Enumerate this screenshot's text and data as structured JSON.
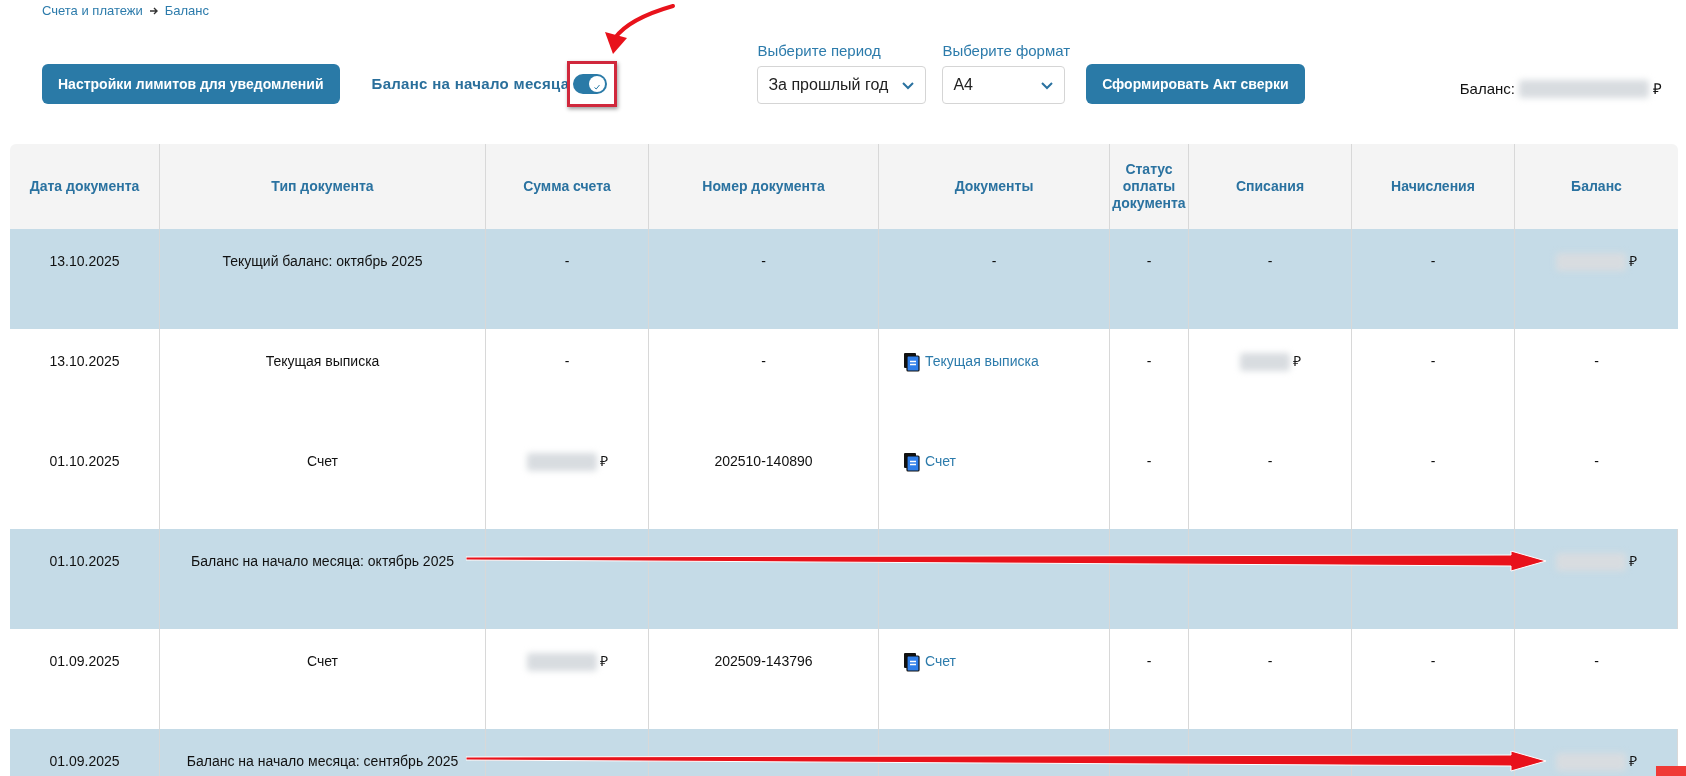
{
  "breadcrumbs": [
    {
      "label": "Счета и платежи"
    },
    {
      "label": "Баланс"
    }
  ],
  "toolbar": {
    "limits_button": "Настройки лимитов для уведомлений",
    "toggle": {
      "label": "Баланс на начало месяца",
      "on": true,
      "highlighted": true
    },
    "period": {
      "label": "Выберите период",
      "value": "За прошлый год"
    },
    "format": {
      "label": "Выберите формат",
      "value": "А4"
    },
    "act_button": "Сформировать Акт сверки",
    "balance": {
      "label": "Баланс:",
      "currency": "₽",
      "masked": true
    }
  },
  "table": {
    "columns": [
      "Дата документа",
      "Тип документа",
      "Сумма счета",
      "Номер документа",
      "Документы",
      "Статус оплаты документа",
      "Списания",
      "Начисления",
      "Баланс"
    ],
    "rows": [
      {
        "highlighted": true,
        "annotated": false,
        "cells": [
          {
            "kind": "text",
            "text": "13.10.2025"
          },
          {
            "kind": "text",
            "text": "Текущий баланс: октябрь 2025"
          },
          {
            "kind": "text",
            "text": "-"
          },
          {
            "kind": "text",
            "text": "-"
          },
          {
            "kind": "text",
            "text": "-"
          },
          {
            "kind": "text",
            "text": "-"
          },
          {
            "kind": "text",
            "text": "-"
          },
          {
            "kind": "text",
            "text": "-"
          },
          {
            "kind": "amount",
            "text": "₽"
          }
        ]
      },
      {
        "highlighted": false,
        "annotated": false,
        "cells": [
          {
            "kind": "text",
            "text": "13.10.2025"
          },
          {
            "kind": "text",
            "text": "Текущая выписка"
          },
          {
            "kind": "text",
            "text": "-"
          },
          {
            "kind": "text",
            "text": "-"
          },
          {
            "kind": "doc",
            "text": "Текущая выписка"
          },
          {
            "kind": "text",
            "text": "-"
          },
          {
            "kind": "amount",
            "text": "₽"
          },
          {
            "kind": "text",
            "text": "-"
          },
          {
            "kind": "text",
            "text": "-"
          }
        ]
      },
      {
        "highlighted": false,
        "annotated": false,
        "cells": [
          {
            "kind": "text",
            "text": "01.10.2025"
          },
          {
            "kind": "text",
            "text": "Счет"
          },
          {
            "kind": "amount",
            "text": "₽"
          },
          {
            "kind": "text",
            "text": "202510-140890"
          },
          {
            "kind": "doc",
            "text": "Счет"
          },
          {
            "kind": "text",
            "text": "-"
          },
          {
            "kind": "text",
            "text": "-"
          },
          {
            "kind": "text",
            "text": "-"
          },
          {
            "kind": "text",
            "text": "-"
          }
        ]
      },
      {
        "highlighted": true,
        "annotated": true,
        "cells": [
          {
            "kind": "text",
            "text": "01.10.2025"
          },
          {
            "kind": "text",
            "text": "Баланс на начало месяца: октябрь 2025"
          },
          {
            "kind": "none"
          },
          {
            "kind": "none"
          },
          {
            "kind": "none"
          },
          {
            "kind": "none"
          },
          {
            "kind": "none"
          },
          {
            "kind": "none"
          },
          {
            "kind": "amount",
            "text": "₽"
          }
        ]
      },
      {
        "highlighted": false,
        "annotated": false,
        "cells": [
          {
            "kind": "text",
            "text": "01.09.2025"
          },
          {
            "kind": "text",
            "text": "Счет"
          },
          {
            "kind": "amount",
            "text": "₽"
          },
          {
            "kind": "text",
            "text": "202509-143796"
          },
          {
            "kind": "doc",
            "text": "Счет"
          },
          {
            "kind": "text",
            "text": "-"
          },
          {
            "kind": "text",
            "text": "-"
          },
          {
            "kind": "text",
            "text": "-"
          },
          {
            "kind": "text",
            "text": "-"
          }
        ]
      },
      {
        "highlighted": true,
        "annotated": true,
        "cells": [
          {
            "kind": "text",
            "text": "01.09.2025"
          },
          {
            "kind": "text",
            "text": "Баланс на начало месяца: сентябрь 2025"
          },
          {
            "kind": "none"
          },
          {
            "kind": "none"
          },
          {
            "kind": "none"
          },
          {
            "kind": "none"
          },
          {
            "kind": "none"
          },
          {
            "kind": "none"
          },
          {
            "kind": "amount",
            "text": "₽"
          }
        ]
      }
    ]
  }
}
